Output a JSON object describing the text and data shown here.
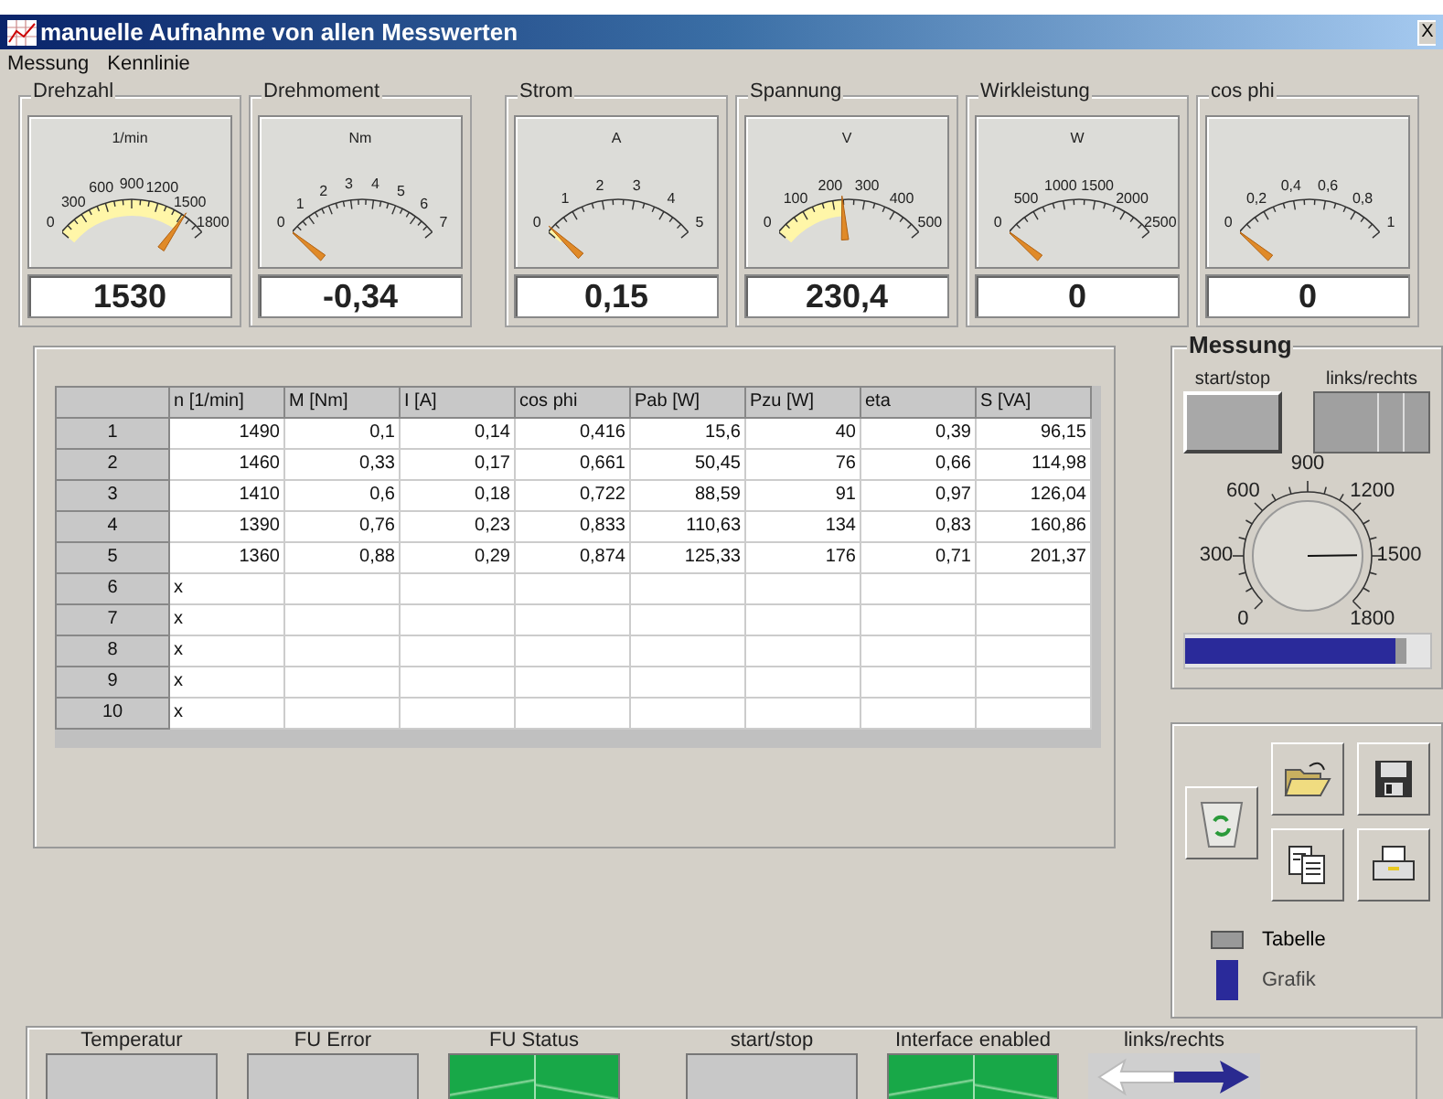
{
  "window": {
    "title": "manuelle Aufnahme von allen Messwerten",
    "close": "X"
  },
  "menu": [
    "Messung",
    "Kennlinie"
  ],
  "gauges": [
    {
      "title": "Drehzahl",
      "unit": "1/min",
      "ticks": [
        "0",
        "300",
        "600",
        "900",
        "1200",
        "1500",
        "1800"
      ],
      "value": "1530"
    },
    {
      "title": "Drehmoment",
      "unit": "Nm",
      "ticks": [
        "0",
        "1",
        "2",
        "3",
        "4",
        "5",
        "6",
        "7"
      ],
      "value": "-0,34"
    },
    {
      "title": "Strom",
      "unit": "A",
      "ticks": [
        "0",
        "1",
        "2",
        "3",
        "4",
        "5"
      ],
      "value": "0,15"
    },
    {
      "title": "Spannung",
      "unit": "V",
      "ticks": [
        "0",
        "100",
        "200",
        "300",
        "400",
        "500"
      ],
      "value": "230,4"
    },
    {
      "title": "Wirkleistung",
      "unit": "W",
      "ticks": [
        "0",
        "500",
        "1000",
        "1500",
        "2000",
        "2500"
      ],
      "value": "0"
    },
    {
      "title": "cos phi",
      "ticks": [
        "0",
        "0,2",
        "0,4",
        "0,6",
        "0,8",
        "1"
      ],
      "value": "0"
    }
  ],
  "table": {
    "columns": [
      "n [1/min]",
      "M [Nm]",
      "I [A]",
      "cos phi",
      "Pab [W]",
      "Pzu [W]",
      "eta",
      "S [VA]"
    ],
    "rows": [
      {
        "header": "1",
        "cells": [
          "1490",
          "0,1",
          "0,14",
          "0,416",
          "15,6",
          "40",
          "0,39",
          "96,15"
        ]
      },
      {
        "header": "2",
        "cells": [
          "1460",
          "0,33",
          "0,17",
          "0,661",
          "50,45",
          "76",
          "0,66",
          "114,98"
        ]
      },
      {
        "header": "3",
        "cells": [
          "1410",
          "0,6",
          "0,18",
          "0,722",
          "88,59",
          "91",
          "0,97",
          "126,04"
        ]
      },
      {
        "header": "4",
        "cells": [
          "1390",
          "0,76",
          "0,23",
          "0,833",
          "110,63",
          "134",
          "0,83",
          "160,86"
        ]
      },
      {
        "header": "5",
        "cells": [
          "1360",
          "0,88",
          "0,29",
          "0,874",
          "125,33",
          "176",
          "0,71",
          "201,37"
        ]
      },
      {
        "header": "6",
        "cells": [
          "x"
        ]
      },
      {
        "header": "7",
        "cells": [
          "x"
        ]
      },
      {
        "header": "8",
        "cells": [
          "x"
        ]
      },
      {
        "header": "9",
        "cells": [
          "x"
        ]
      },
      {
        "header": "10",
        "cells": [
          "x"
        ]
      }
    ]
  },
  "messung": {
    "title": "Messung",
    "start_label": "start/stop",
    "direction_label": "links/rechts",
    "knob_ticks": [
      "0",
      "300",
      "600",
      "900",
      "1200",
      "1500",
      "1800"
    ],
    "direction_toggle": {
      "on": true
    },
    "slider": {
      "level": 0.9
    }
  },
  "tools": [
    {
      "kind": "recycle"
    },
    {
      "kind": "open"
    },
    {
      "kind": "save"
    },
    {
      "kind": "copy"
    },
    {
      "kind": "print"
    }
  ],
  "view_switch": [
    {
      "label": "Tabelle",
      "selected": true
    },
    {
      "label": "Grafik",
      "selected": false
    }
  ],
  "status": [
    {
      "label": "Temperatur",
      "kind": "lamp",
      "on": false
    },
    {
      "label": "FU Error",
      "kind": "lamp",
      "on": false
    },
    {
      "label": "FU Status",
      "kind": "lamp",
      "on": true
    },
    {
      "label": "start/stop",
      "kind": "lamp",
      "on": false
    },
    {
      "label": "Interface enabled",
      "kind": "lamp",
      "on": true
    },
    {
      "label": "links/rechts",
      "kind": "arrow"
    }
  ]
}
